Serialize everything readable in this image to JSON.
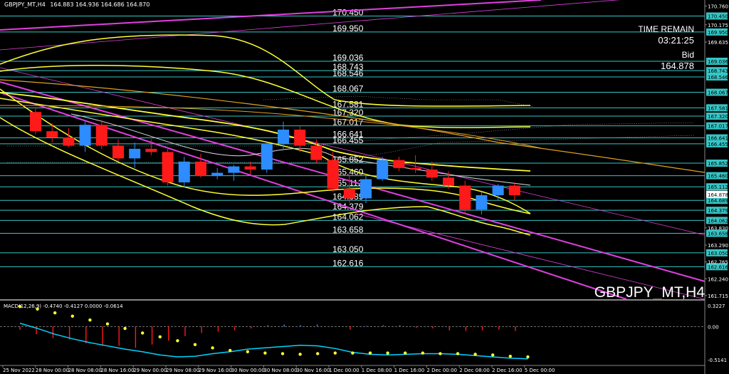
{
  "header": {
    "symbol_line": "GBPJPY_MT,H4",
    "ohlc": "164.883 164.936 164.686 164.870"
  },
  "watermark": "GBPJPY_MT,H4",
  "info": {
    "time_remain_label": "TIME REMAIN",
    "time_remain_value": "03:21:25",
    "bid_label": "Bid",
    "bid_value": "164.878"
  },
  "level_lines": [
    {
      "label": "170.450",
      "value": 170.45
    },
    {
      "label": "169.950",
      "value": 169.95
    },
    {
      "label": "169.036",
      "value": 169.036
    },
    {
      "label": "168.743",
      "value": 168.743
    },
    {
      "label": "168.546",
      "value": 168.546
    },
    {
      "label": "168.067",
      "value": 168.067
    },
    {
      "label": "167.581",
      "value": 167.581
    },
    {
      "label": "167.320",
      "value": 167.32
    },
    {
      "label": "167.017",
      "value": 167.017
    },
    {
      "label": "166.641",
      "value": 166.641
    },
    {
      "label": "166.455",
      "value": 166.455
    },
    {
      "label": "165.852",
      "value": 165.852
    },
    {
      "label": "165.460",
      "value": 165.46
    },
    {
      "label": "165.112",
      "value": 165.112
    },
    {
      "label": "164.689",
      "value": 164.689
    },
    {
      "label": "164.379",
      "value": 164.379
    },
    {
      "label": "164.062",
      "value": 164.062
    },
    {
      "label": "163.658",
      "value": 163.658
    },
    {
      "label": "163.050",
      "value": 163.05
    },
    {
      "label": "162.616",
      "value": 162.616
    }
  ],
  "price_axis": {
    "ticks": [
      "170.760",
      "170.175",
      "169.635",
      "163.830",
      "163.290",
      "162.765",
      "162.240",
      "161.715"
    ],
    "current_price": "164.878"
  },
  "colors": {
    "background": "#000000",
    "bull_candle": "#2d8cff",
    "bear_candle": "#ff1a1a",
    "level_line": "#36c5c5",
    "ma_line": "#ffff33",
    "trend_channel": "#e040e0",
    "macd_line": "#00d4ff",
    "macd_signal": "#ffff33"
  },
  "chart_data": {
    "type": "candlestick",
    "ylim": [
      161.6,
      170.95
    ],
    "candles": [
      {
        "o": 167.45,
        "h": 167.6,
        "l": 166.75,
        "c": 166.85
      },
      {
        "o": 166.85,
        "h": 167.1,
        "l": 166.5,
        "c": 166.65
      },
      {
        "o": 166.65,
        "h": 166.95,
        "l": 166.35,
        "c": 166.4
      },
      {
        "o": 166.4,
        "h": 167.2,
        "l": 166.2,
        "c": 167.05
      },
      {
        "o": 167.05,
        "h": 167.2,
        "l": 166.3,
        "c": 166.4
      },
      {
        "o": 166.4,
        "h": 166.6,
        "l": 165.9,
        "c": 166.0
      },
      {
        "o": 166.0,
        "h": 166.5,
        "l": 165.7,
        "c": 166.3
      },
      {
        "o": 166.3,
        "h": 166.6,
        "l": 166.1,
        "c": 166.2
      },
      {
        "o": 166.2,
        "h": 166.35,
        "l": 165.15,
        "c": 165.25
      },
      {
        "o": 165.25,
        "h": 166.05,
        "l": 165.1,
        "c": 165.9
      },
      {
        "o": 165.9,
        "h": 166.15,
        "l": 165.4,
        "c": 165.45
      },
      {
        "o": 165.45,
        "h": 165.7,
        "l": 165.35,
        "c": 165.55
      },
      {
        "o": 165.55,
        "h": 165.8,
        "l": 165.3,
        "c": 165.75
      },
      {
        "o": 165.75,
        "h": 165.9,
        "l": 165.5,
        "c": 165.65
      },
      {
        "o": 165.65,
        "h": 166.5,
        "l": 165.55,
        "c": 166.45
      },
      {
        "o": 166.45,
        "h": 167.15,
        "l": 166.3,
        "c": 166.9
      },
      {
        "o": 166.9,
        "h": 167.0,
        "l": 166.2,
        "c": 166.4
      },
      {
        "o": 166.4,
        "h": 166.6,
        "l": 165.85,
        "c": 165.95
      },
      {
        "o": 165.95,
        "h": 166.2,
        "l": 164.95,
        "c": 165.05
      },
      {
        "o": 165.05,
        "h": 165.5,
        "l": 164.6,
        "c": 164.75
      },
      {
        "o": 164.75,
        "h": 165.45,
        "l": 164.6,
        "c": 165.35
      },
      {
        "o": 165.35,
        "h": 166.05,
        "l": 165.3,
        "c": 165.95
      },
      {
        "o": 165.95,
        "h": 166.05,
        "l": 165.6,
        "c": 165.7
      },
      {
        "o": 165.7,
        "h": 166.1,
        "l": 165.55,
        "c": 165.65
      },
      {
        "o": 165.65,
        "h": 165.9,
        "l": 165.3,
        "c": 165.4
      },
      {
        "o": 165.4,
        "h": 165.6,
        "l": 165.05,
        "c": 165.15
      },
      {
        "o": 165.15,
        "h": 165.3,
        "l": 164.25,
        "c": 164.4
      },
      {
        "o": 164.4,
        "h": 164.95,
        "l": 164.25,
        "c": 164.85
      },
      {
        "o": 164.85,
        "h": 165.2,
        "l": 164.7,
        "c": 165.15
      },
      {
        "o": 165.15,
        "h": 165.25,
        "l": 164.7,
        "c": 164.85
      }
    ],
    "macd": {
      "label": "MACD(12,26,9) -0.4740 -0.4127 0.0000 -0.0614",
      "levels": [
        "0.3227",
        "0.00",
        "-0.5141"
      ],
      "histogram": [
        -0.05,
        -0.12,
        -0.18,
        -0.2,
        -0.26,
        -0.3,
        -0.3,
        -0.33,
        -0.28,
        -0.22,
        -0.15,
        -0.1,
        -0.08,
        -0.06,
        -0.03,
        0.02,
        0.03,
        0.02,
        0.03,
        0.0,
        -0.05,
        0.01,
        0.02,
        0.02,
        -0.02,
        -0.03,
        -0.06,
        -0.07,
        -0.06,
        -0.05,
        -0.07
      ],
      "line": [
        0.05,
        -0.03,
        -0.12,
        -0.19,
        -0.25,
        -0.3,
        -0.35,
        -0.39,
        -0.44,
        -0.47,
        -0.46,
        -0.42,
        -0.39,
        -0.35,
        -0.33,
        -0.31,
        -0.29,
        -0.3,
        -0.34,
        -0.4,
        -0.43,
        -0.44,
        -0.43,
        -0.42,
        -0.42,
        -0.43,
        -0.45,
        -0.47,
        -0.49,
        -0.5
      ],
      "signal": [
        0.31,
        0.27,
        0.21,
        0.16,
        0.1,
        0.04,
        -0.03,
        -0.1,
        -0.16,
        -0.22,
        -0.28,
        -0.33,
        -0.37,
        -0.39,
        -0.41,
        -0.42,
        -0.43,
        -0.42,
        -0.41,
        -0.41,
        -0.41,
        -0.41,
        -0.41,
        -0.41,
        -0.42,
        -0.42,
        -0.43,
        -0.44,
        -0.46,
        -0.47
      ]
    },
    "x_labels": [
      "25 Nov 2022",
      "28 Nov 00:00",
      "28 Nov 08:00",
      "28 Nov 16:00",
      "29 Nov 00:00",
      "29 Nov 08:00",
      "29 Nov 16:00",
      "30 Nov 00:00",
      "30 Nov 08:00",
      "30 Nov 16:00",
      "1 Dec 00:00",
      "1 Dec 08:00",
      "1 Dec 16:00",
      "2 Dec 00:00",
      "2 Dec 08:00",
      "2 Dec 16:00",
      "5 Dec 00:00"
    ]
  }
}
